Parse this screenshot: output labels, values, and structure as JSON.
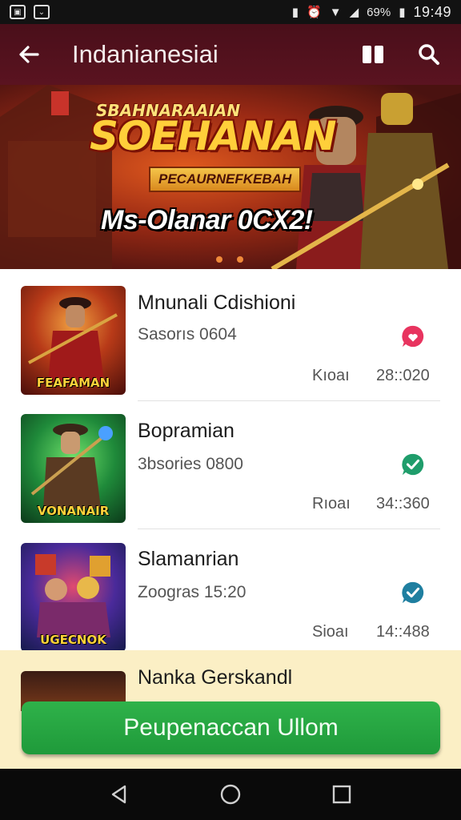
{
  "status_bar": {
    "battery_percent": "69%",
    "time": "19:49"
  },
  "app_bar": {
    "title": "Indanianesiai",
    "icons": [
      "back-arrow-icon",
      "book-icon",
      "search-icon"
    ]
  },
  "banner": {
    "title_small": "SBAHNARAAIAN",
    "title_big": "SOEHANAN",
    "ribbon": "PECAURNEFKEBAH",
    "subtitle": "Ms-Olanar 0CX2!",
    "page_dots": 2
  },
  "list": {
    "items": [
      {
        "title": "Mnunali Cdishioni",
        "subtitle": "Sasorıs 0604",
        "meta_label": "Kıoaı",
        "meta_value": "28::020",
        "thumb_caption": "FEAFAMAN",
        "badge": "heart-chat-icon",
        "badge_color": "#e8345f"
      },
      {
        "title": "Bopramian",
        "subtitle": "3bsories 0800",
        "meta_label": "Rıoaı",
        "meta_value": "34::360",
        "thumb_caption": "VONANAIR",
        "badge": "check-chat-icon",
        "badge_color": "#1f9d6b"
      },
      {
        "title": "Slamanrian",
        "subtitle": "Zoogras 15:20",
        "meta_label": "Sioaı",
        "meta_value": "14::488",
        "thumb_caption": "UGECNOK",
        "badge": "check-chat-icon",
        "badge_color": "#1f7fa0"
      }
    ]
  },
  "sheet": {
    "title": "Nanka Gerskandl",
    "cta_label": "Peupenaccan Ullom"
  },
  "colors": {
    "app_bar": "#4a0f1a",
    "cta": "#27a843",
    "sheet": "#fbefc5"
  }
}
